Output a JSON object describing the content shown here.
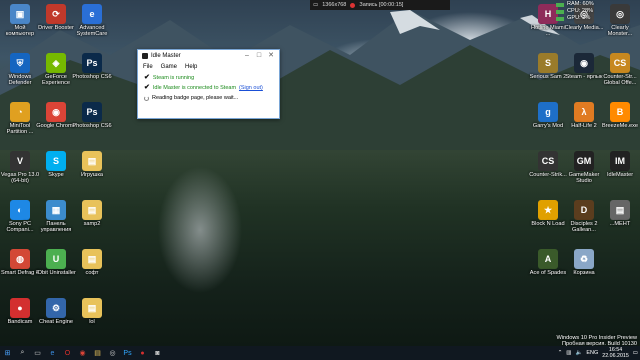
{
  "recorder": {
    "resolution": "1366x768",
    "recording": "Запись [00:00:15]"
  },
  "stats": {
    "ram": "RAM: 60%",
    "cpu": "CPU: 28%",
    "gpu": "GPU: 2%"
  },
  "left_icons": [
    {
      "label": "Мой компьютер",
      "color": "#4a86c8",
      "glyph": "▣"
    },
    {
      "label": "Driver Booster",
      "color": "#c0392b",
      "glyph": "⟳"
    },
    {
      "label": "Advanced SystemCare",
      "color": "#2a6fd6",
      "glyph": "e"
    },
    {
      "label": "Windows Defender",
      "color": "#1565c0",
      "glyph": "⛨"
    },
    {
      "label": "GeForce Experience",
      "color": "#76b900",
      "glyph": "◈"
    },
    {
      "label": "Photoshop CS6",
      "color": "#0b2a4a",
      "glyph": "Ps"
    },
    {
      "label": "MiniTool Partition ...",
      "color": "#e0a020",
      "glyph": "◔"
    },
    {
      "label": "Google Chrome",
      "color": "#db4437",
      "glyph": "◉"
    },
    {
      "label": "Photoshop CS6",
      "color": "#0b2a4a",
      "glyph": "Ps"
    },
    {
      "label": "Vegas Pro 13.0 (64-bit)",
      "color": "#333",
      "glyph": "V"
    },
    {
      "label": "Skype",
      "color": "#00aff0",
      "glyph": "S"
    },
    {
      "label": "Игрушка",
      "color": "#e8c25a",
      "glyph": "▤"
    },
    {
      "label": "Sony PC Compani...",
      "color": "#1e88e5",
      "glyph": "◐"
    },
    {
      "label": "Панель управления",
      "color": "#3c8ccd",
      "glyph": "▦"
    },
    {
      "label": "samp2",
      "color": "#e8c25a",
      "glyph": "▤"
    },
    {
      "label": "Smart Defrag 4",
      "color": "#d34836",
      "glyph": "◍"
    },
    {
      "label": "IObit Uninstaller",
      "color": "#4caf50",
      "glyph": "U"
    },
    {
      "label": "софт",
      "color": "#e8c25a",
      "glyph": "▤"
    },
    {
      "label": "Bandicam",
      "color": "#d32f2f",
      "glyph": "●"
    },
    {
      "label": "Cheat Engine",
      "color": "#3366aa",
      "glyph": "⚙"
    },
    {
      "label": "lol",
      "color": "#e8c25a",
      "glyph": "▤"
    }
  ],
  "right_icons": [
    {
      "label": "Hotline Miami ...",
      "color": "#8e2b5a",
      "glyph": "H"
    },
    {
      "label": "Clearly Media...",
      "color": "#444",
      "glyph": "◎"
    },
    {
      "label": "Clearly Monster...",
      "color": "#3a3a3a",
      "glyph": "◎"
    },
    {
      "label": "Serious Sam 2",
      "color": "#9a7b2a",
      "glyph": "S"
    },
    {
      "label": "Steam - ярлык",
      "color": "#1b2838",
      "glyph": "◉"
    },
    {
      "label": "Counter-Str... Global Offe...",
      "color": "#c7881f",
      "glyph": "CS"
    },
    {
      "label": "Garry's Mod",
      "color": "#1e6fc8",
      "glyph": "g"
    },
    {
      "label": "Half-Life 2",
      "color": "#e07b22",
      "glyph": "λ"
    },
    {
      "label": "BreezeMe.exe",
      "color": "#ff8a00",
      "glyph": "B"
    },
    {
      "label": "Counter-Strik...",
      "color": "#333",
      "glyph": "CS"
    },
    {
      "label": "GameMaker Studio",
      "color": "#222",
      "glyph": "GM"
    },
    {
      "label": "IdleMaster",
      "color": "#222",
      "glyph": "IM"
    },
    {
      "label": "Block N Load",
      "color": "#e0a000",
      "glyph": "★"
    },
    {
      "label": "Disciples 2 Gallean...",
      "color": "#5b3d1e",
      "glyph": "D"
    },
    {
      "label": "...МЕНТ",
      "color": "#666",
      "glyph": "▤"
    },
    {
      "label": "Ace of Spades",
      "color": "#3a5a2a",
      "glyph": "A"
    },
    {
      "label": "Корзина",
      "color": "#8aa7c7",
      "glyph": "♻"
    }
  ],
  "window": {
    "title": "Idle Master",
    "menu": [
      "File",
      "Game",
      "Help"
    ],
    "line1": "Steam is running",
    "line2": "Idle Master is connected to Steam",
    "sign_out": "(Sign out)",
    "status": "Reading badge page, please wait..."
  },
  "watermark": {
    "line1": "Windows 10 Pro Insider Preview",
    "line2": "Пробная версия. Build 10130"
  },
  "tray": {
    "lang": "ENG",
    "time": "16:54",
    "date": "22.06.2015"
  }
}
